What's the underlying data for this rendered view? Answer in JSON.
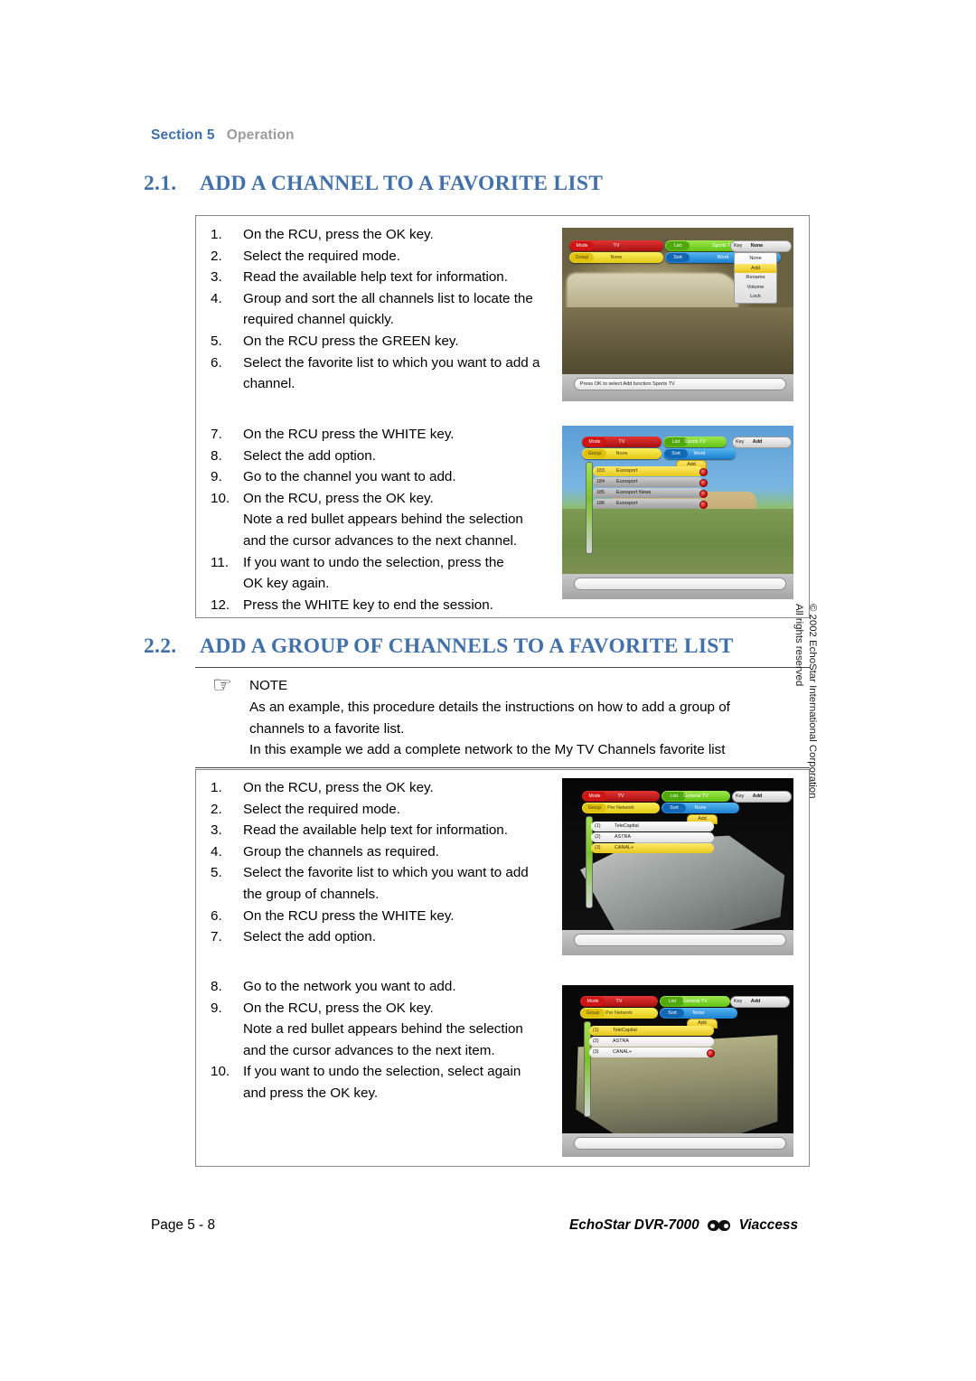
{
  "running_head": {
    "section_label": "Section 5",
    "section_name": "Operation"
  },
  "headings": {
    "h1_num": "2.1.",
    "h1_text": "ADD A CHANNEL TO A FAVORITE LIST",
    "h2_num": "2.2.",
    "h2_text": "ADD A GROUP OF CHANNELS TO A FAVORITE LIST"
  },
  "procedure_1": {
    "steps_a": [
      {
        "n": "1.",
        "text": "On the RCU, press the OK key."
      },
      {
        "n": "2.",
        "text": "Select the required mode."
      },
      {
        "n": "3.",
        "text": "Read the available help text for information."
      },
      {
        "n": "4.",
        "text": "Group and sort the all channels list to locate the",
        "cont": "required channel quickly."
      },
      {
        "n": "5.",
        "text": "On the RCU press the GREEN key."
      },
      {
        "n": "6.",
        "text": "Select the favorite list to which you want to add a",
        "cont": "channel."
      }
    ],
    "steps_b": [
      {
        "n": "7.",
        "text": "On the RCU press the WHITE key."
      },
      {
        "n": "8.",
        "text": "Select the add option."
      },
      {
        "n": "9.",
        "text": "Go to the channel you want to add."
      },
      {
        "n": "10.",
        "text": "On the RCU, press the OK key.",
        "cont": "Note a red bullet appears behind the selection",
        "cont2": "and the cursor advances to the next channel."
      },
      {
        "n": "11.",
        "text": "If you want to undo the selection, press the",
        "cont": "OK key again."
      },
      {
        "n": "12.",
        "text": "Press the WHITE key to end the session."
      }
    ]
  },
  "note": {
    "icon": "pointing-hand-icon",
    "title": "NOTE",
    "line1": "As an example, this procedure details the instructions on how to add a group of",
    "line2": "channels to a favorite list.",
    "line3": "In this example we add a complete network to the My TV Channels favorite list"
  },
  "procedure_2": {
    "steps_a": [
      {
        "n": "1.",
        "text": "On the RCU, press the OK key."
      },
      {
        "n": "2.",
        "text": "Select the required mode."
      },
      {
        "n": "3.",
        "text": "Read the available help text for information."
      },
      {
        "n": "4.",
        "text": "Group the channels as required."
      },
      {
        "n": "5.",
        "text": "Select the favorite list to which you want to add",
        "cont": "the group of channels."
      },
      {
        "n": "6.",
        "text": "On the RCU press the WHITE key."
      },
      {
        "n": "7.",
        "text": "Select the add option."
      }
    ],
    "steps_b": [
      {
        "n": "8.",
        "text": "Go to the network you want to add."
      },
      {
        "n": "9.",
        "text": "On the RCU, press the OK key.",
        "cont": "Note a red bullet appears behind the selection",
        "cont2": "and the cursor advances to the next item."
      },
      {
        "n": "10.",
        "text": "If you want to undo the selection, select again",
        "cont": "and press the OK key."
      }
    ]
  },
  "screenshots": {
    "shot1": {
      "caption": "rally-car-osd-screenshot",
      "bar_red_key": "Mode",
      "bar_red_value": "TV",
      "bar_green_key": "List",
      "bar_green_value": "Sports TV",
      "bar_yellow_key": "Group",
      "bar_yellow_value": "None",
      "bar_blue_key": "Sort",
      "bar_blue_value": "Word",
      "pill_key": "Key",
      "pill_value": "None",
      "menu_items": [
        "None",
        "Add",
        "Rename",
        "Volume",
        "Lock"
      ],
      "menu_selected": "Add",
      "help_text": "Press OK to select Add function Sports TV"
    },
    "shot2": {
      "caption": "jeep-osd-screenshot",
      "bar_red_key": "Mode",
      "bar_red_value": "TV",
      "bar_green_key": "List",
      "bar_green_value": "Sports TV",
      "bar_yellow_key": "Group",
      "bar_yellow_value": "None",
      "bar_blue_key": "Sort",
      "bar_blue_value": "Word",
      "pill_key": "Key",
      "pill_value": "Add",
      "add_tab": "Add",
      "rows": [
        {
          "num": "183",
          "name": "Eurosport",
          "bullet": true
        },
        {
          "num": "184",
          "name": "Eurosport",
          "bullet": true
        },
        {
          "num": "185",
          "name": "Eurosport News",
          "bullet": true
        },
        {
          "num": "186",
          "name": "Eurosport",
          "bullet": true
        }
      ]
    },
    "shot3": {
      "caption": "chassis-osd-screenshot",
      "bar_red_key": "Mode",
      "bar_red_value": "TV",
      "bar_green_key": "List",
      "bar_green_value": "General TV",
      "bar_yellow_key": "Group",
      "bar_yellow_value": "Per Network",
      "bar_blue_key": "Sort",
      "bar_blue_value": "None",
      "pill_key": "Key",
      "pill_value": "Add",
      "add_tab": "Add",
      "rows": [
        {
          "num": "(1)",
          "name": "TeleCapital",
          "bullet": false
        },
        {
          "num": "(2)",
          "name": "ASTRA",
          "bullet": false
        },
        {
          "num": "(3)",
          "name": "CANAL+",
          "bullet": false
        }
      ]
    },
    "shot4": {
      "caption": "engine-osd-screenshot",
      "bar_red_key": "Mode",
      "bar_red_value": "TV",
      "bar_green_key": "List",
      "bar_green_value": "General TV",
      "bar_yellow_key": "Group",
      "bar_yellow_value": "Per Network",
      "bar_blue_key": "Sort",
      "bar_blue_value": "None",
      "pill_key": "Key",
      "pill_value": "Add",
      "add_tab": "Add",
      "rows": [
        {
          "num": "(1)",
          "name": "TeleCapital",
          "bullet": false
        },
        {
          "num": "(2)",
          "name": "ASTRA",
          "bullet": false
        },
        {
          "num": "(3)",
          "name": "CANAL+",
          "bullet": true
        }
      ]
    }
  },
  "copyright": {
    "line1": "© 2002 EchoStar International Corporation",
    "line2": "All rights reserved"
  },
  "footer": {
    "page": "Page 5 - 8",
    "product": "EchoStar DVR-7000",
    "logo": "viaccess-logo",
    "brand": "Viaccess"
  },
  "colors": {
    "heading_blue": "#4270a8",
    "running_head_blue": "#3f6fad",
    "running_head_grey": "#9b9b9b",
    "box_border": "#8a8a8a"
  }
}
